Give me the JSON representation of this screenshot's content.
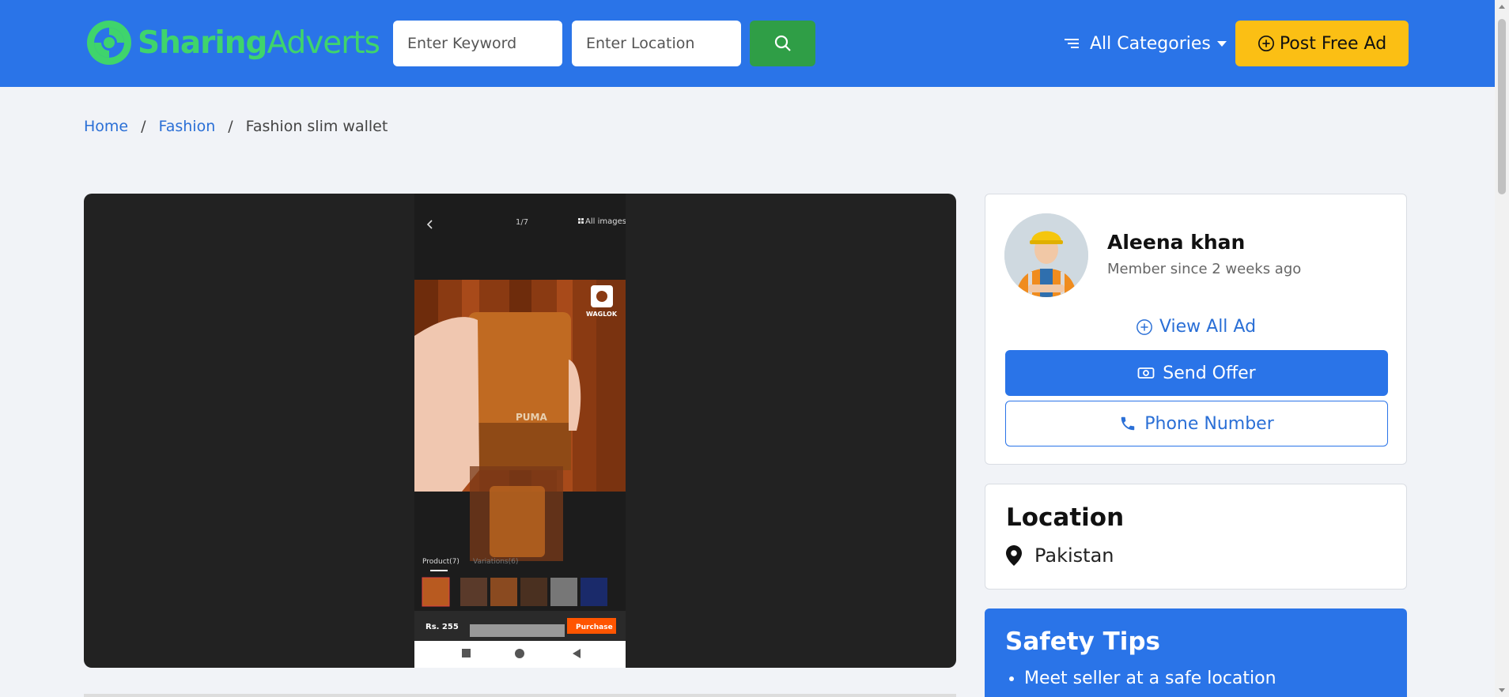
{
  "header": {
    "logo_part1": "Sharing",
    "logo_part2": "Adverts",
    "keyword_placeholder": "Enter Keyword",
    "location_placeholder": "Enter Location",
    "categories_label": "All Categories",
    "post_ad_label": "Post Free Ad"
  },
  "breadcrumb": {
    "home": "Home",
    "category": "Fashion",
    "current": "Fashion slim wallet"
  },
  "gallery": {
    "counter": "1/7",
    "all_images": "All images",
    "brand_watermark": "WAGLOK",
    "tab_product": "Product(7)",
    "tab_variations": "Variations(6)",
    "price": "Rs. 255",
    "purchase": "Purchase"
  },
  "seller": {
    "name": "Aleena khan",
    "member_since": "Member since 2 weeks ago",
    "view_all": "View All Ad",
    "send_offer": "Send Offer",
    "phone": "Phone Number"
  },
  "location": {
    "title": "Location",
    "place": "Pakistan"
  },
  "safety": {
    "title": "Safety Tips",
    "tips": [
      "Meet seller at a safe location"
    ]
  },
  "colors": {
    "header_bg": "#2a74e8",
    "logo_green": "#3fd46c",
    "search_green": "#2f9e46",
    "post_yellow": "#fbbf14",
    "link_blue": "#2a6fd6"
  }
}
